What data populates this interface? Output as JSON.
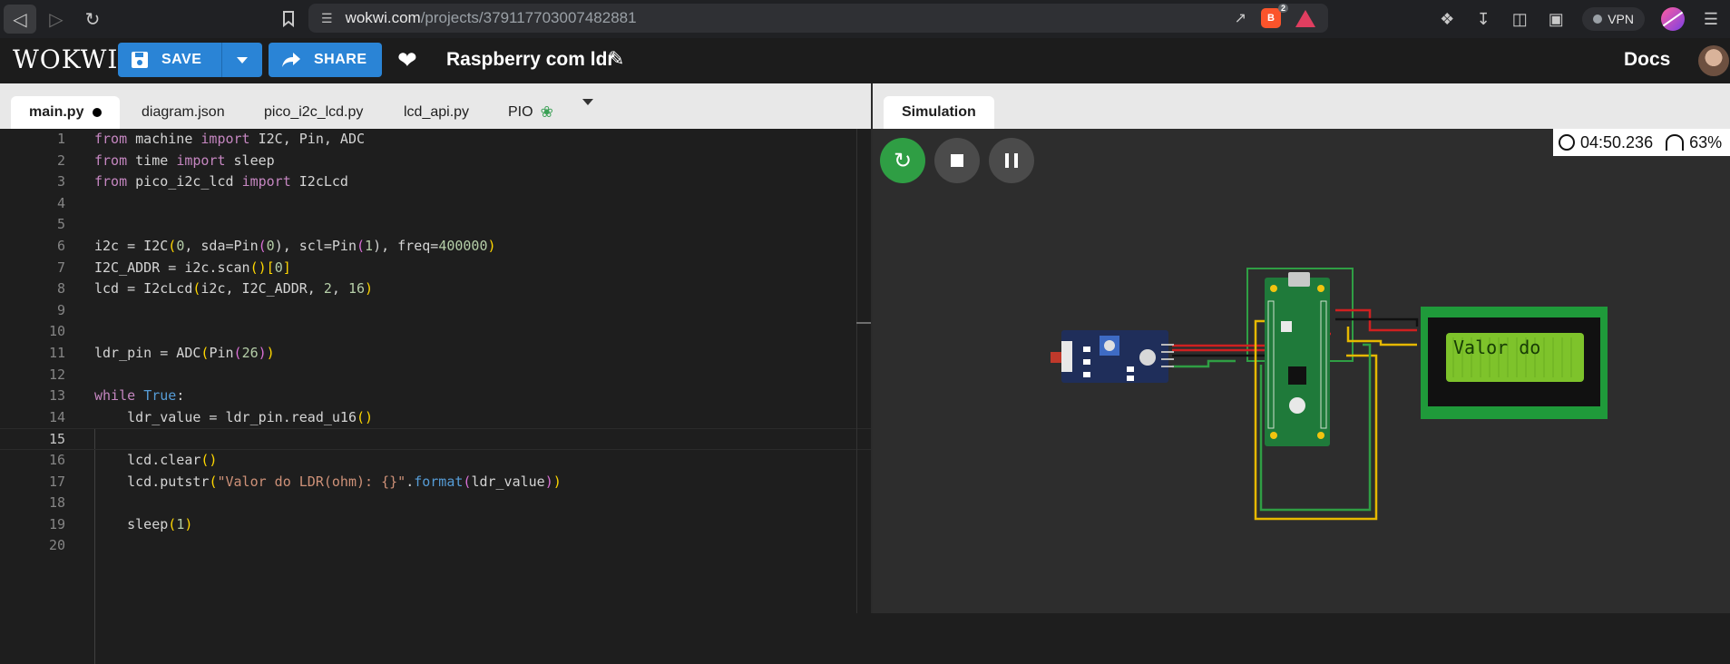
{
  "browser": {
    "url_domain": "wokwi.com",
    "url_path": "/projects/379117703007482881",
    "shields_count": "2",
    "vpn_label": "VPN"
  },
  "header": {
    "logo": "WOKWI",
    "save_label": "SAVE",
    "share_label": "SHARE",
    "project_title": "Raspberry com ldr",
    "docs_label": "Docs"
  },
  "editor": {
    "tabs": [
      {
        "label": "main.py"
      },
      {
        "label": "diagram.json"
      },
      {
        "label": "pico_i2c_lcd.py"
      },
      {
        "label": "lcd_api.py"
      },
      {
        "label": "PIO"
      }
    ],
    "line_numbers": [
      "1",
      "2",
      "3",
      "4",
      "5",
      "6",
      "7",
      "8",
      "9",
      "10",
      "11",
      "12",
      "13",
      "14",
      "15",
      "16",
      "17",
      "18",
      "19",
      "20"
    ],
    "tokens": {
      "l1": [
        "from",
        " machine ",
        "import",
        " I2C, Pin, ADC"
      ],
      "l2": [
        "from",
        " time ",
        "import",
        " sleep"
      ],
      "l3": [
        "from",
        " pico_i2c_lcd ",
        "import",
        " I2cLcd"
      ],
      "l6": [
        "i2c = I2C",
        "(",
        "0",
        ", sda=Pin",
        "(",
        "0",
        "), scl=Pin",
        "(",
        "1",
        "), freq=",
        "400000",
        ")"
      ],
      "l7": [
        "I2C_ADDR = i2c.scan",
        "()",
        "[",
        "0",
        "]"
      ],
      "l8": [
        "lcd = I2cLcd",
        "(",
        "i2c, I2C_ADDR, ",
        "2",
        ", ",
        "16",
        ")"
      ],
      "l11": [
        "ldr_pin = ADC",
        "(",
        "Pin",
        "(",
        "26",
        ")",
        ")"
      ],
      "l13": [
        "while",
        " ",
        "True",
        ":"
      ],
      "l14": [
        "    ldr_value = ldr_pin.read_u16",
        "()"
      ],
      "l16": [
        "    lcd.clear",
        "()"
      ],
      "l17": [
        "    lcd.putstr",
        "(",
        "\"Valor do LDR(ohm): {}\"",
        ".",
        "format",
        "(",
        "ldr_value",
        ")",
        ")"
      ],
      "l19": [
        "    sleep",
        "(",
        "1",
        ")"
      ]
    }
  },
  "simulation": {
    "tab_label": "Simulation",
    "elapsed_time": "04:50.236",
    "speed": "63%",
    "lcd_text": "Valor do"
  },
  "icons": {
    "back": "back-arrow-icon",
    "forward": "forward-arrow-icon",
    "reload": "reload-icon",
    "save": "floppy-disk-icon",
    "share": "share-arrow-icon",
    "like": "heart-icon",
    "edit": "pencil-icon"
  }
}
